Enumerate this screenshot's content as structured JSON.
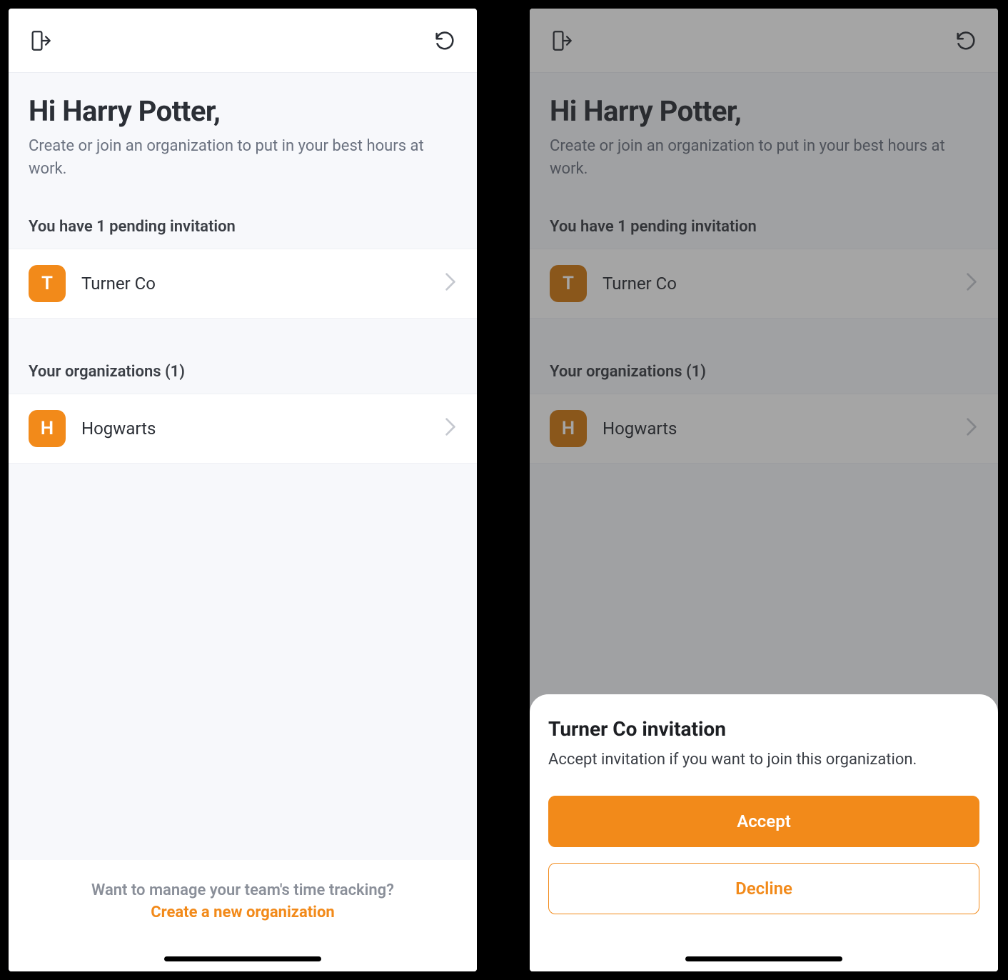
{
  "greeting": {
    "title": "Hi Harry Potter,",
    "subtitle": "Create or join an organization to put in your best hours at work."
  },
  "invitations": {
    "header": "You have 1 pending invitation",
    "items": [
      {
        "initial": "T",
        "name": "Turner Co"
      }
    ]
  },
  "organizations": {
    "header": "Your organizations (1)",
    "items": [
      {
        "initial": "H",
        "name": "Hogwarts"
      }
    ]
  },
  "footer": {
    "question": "Want to manage your team's time tracking?",
    "link": "Create a new organization"
  },
  "sheet": {
    "title": "Turner Co invitation",
    "subtitle": "Accept invitation if you want to join this organization.",
    "accept": "Accept",
    "decline": "Decline"
  }
}
